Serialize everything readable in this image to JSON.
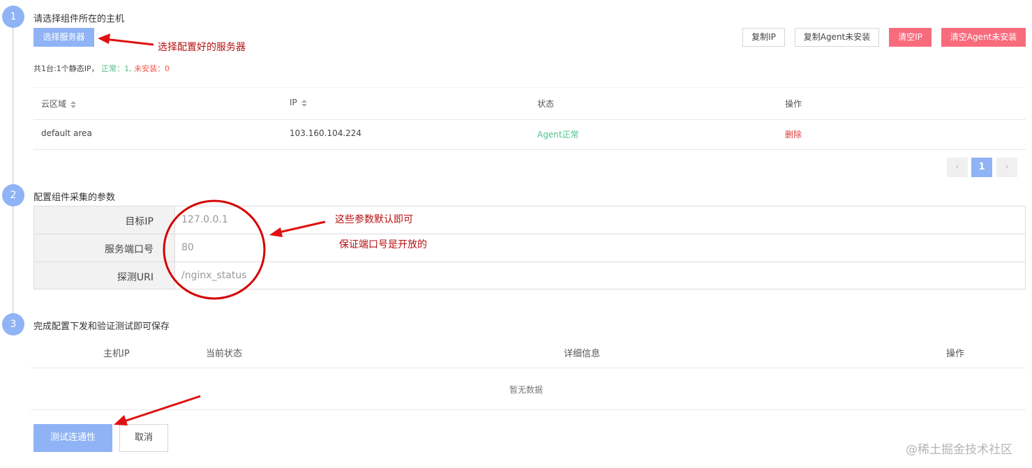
{
  "step1": {
    "number": "1",
    "title": "请选择组件所在的主机",
    "select_server_button": "选择服务器",
    "annotation": "选择配置好的服务器",
    "copy_ip_button": "复制IP",
    "copy_agent_button": "复制Agent未安装",
    "clear_ip_button": "清空IP",
    "clear_agent_button": "清空Agent未安装",
    "summary_prefix": "共1台:1个静态IP，",
    "summary_normal": "正常：1,",
    "summary_uninstalled": "未安装：0",
    "table": {
      "headers": [
        "云区域",
        "IP",
        "状态",
        "操作"
      ],
      "rows": [
        {
          "area": "default area",
          "ip": "103.160.104.224",
          "status": "Agent正常",
          "action": "删除"
        }
      ]
    },
    "pagination": {
      "prev": "‹",
      "current": "1",
      "next": "›"
    }
  },
  "step2": {
    "number": "2",
    "title": "配置组件采集的参数",
    "annotation1": "这些参数默认即可",
    "annotation2": "保证端口号是开放的",
    "fields": [
      {
        "label": "目标IP",
        "value": "127.0.0.1"
      },
      {
        "label": "服务端口号",
        "value": "80"
      },
      {
        "label": "探测URI",
        "value": "/nginx_status"
      }
    ]
  },
  "step3": {
    "number": "3",
    "title": "完成配置下发和验证测试即可保存",
    "table": {
      "headers": [
        "主机IP",
        "当前状态",
        "详细信息",
        "操作"
      ],
      "empty_text": "暂无数据"
    },
    "test_button": "测试连通性",
    "cancel_button": "取消"
  },
  "watermark": "@稀土掘金技术社区",
  "colors": {
    "primary": "#8fb3f5",
    "danger": "#f86b7d",
    "success": "#4fc08d",
    "warning": "#f5554a",
    "annotation": "#d40000"
  }
}
